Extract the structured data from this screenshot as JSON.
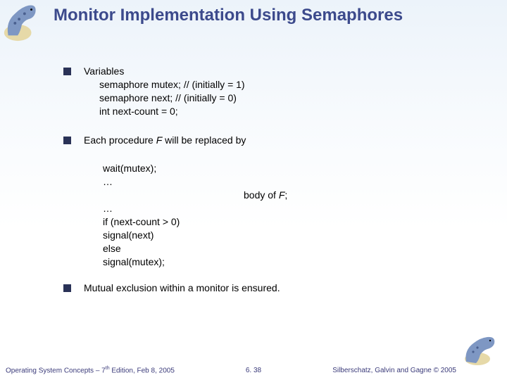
{
  "title": "Monitor Implementation Using Semaphores",
  "bullets": {
    "b1": {
      "head": "Variables",
      "l1": "semaphore mutex;  // (initially  = 1)",
      "l2": "semaphore next;     // (initially  = 0)",
      "l3": "int next-count = 0;"
    },
    "b2": {
      "pre": "Each procedure ",
      "f": "F",
      "post": "  will be replaced by"
    },
    "code": {
      "c1": "wait(mutex);",
      "c2": "   …",
      "body_pre": "body of ",
      "body_f": "F",
      "body_post": ";",
      "c3": "            …",
      "c4": "if (next-count > 0)",
      "c5": "        signal(next)",
      "c6": "else",
      "c7": "        signal(mutex);"
    },
    "b3": "Mutual exclusion within a monitor is ensured."
  },
  "footer": {
    "left_pre": "Operating System Concepts – 7",
    "left_sup": "th",
    "left_post": " Edition, Feb 8, 2005",
    "center": "6. 38",
    "right": "Silberschatz, Galvin and Gagne © 2005"
  }
}
